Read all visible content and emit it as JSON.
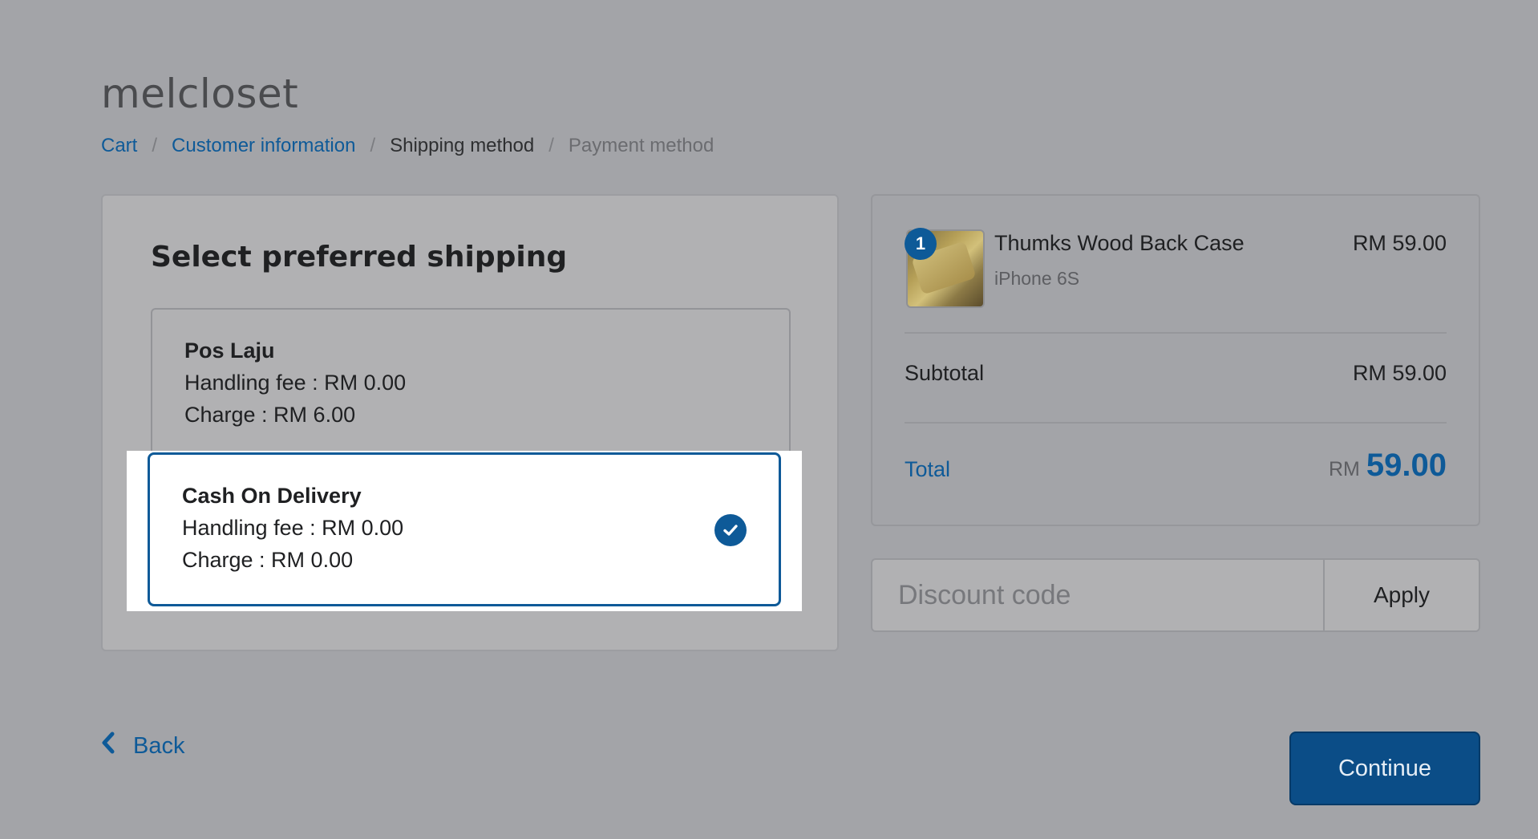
{
  "store": {
    "name": "melcloset"
  },
  "breadcrumb": {
    "items": [
      {
        "label": "Cart"
      },
      {
        "label": "Customer information"
      },
      {
        "label": "Shipping method"
      },
      {
        "label": "Payment method"
      }
    ],
    "separator": "/"
  },
  "shipping": {
    "title": "Select preferred shipping",
    "options": [
      {
        "name": "Pos Laju",
        "handling": "Handling fee : RM 0.00",
        "charge": "Charge : RM 6.00",
        "selected": false
      },
      {
        "name": "Cash On Delivery",
        "handling": "Handling fee : RM 0.00",
        "charge": "Charge : RM 0.00",
        "selected": true
      }
    ]
  },
  "summary": {
    "product": {
      "quantity": "1",
      "name": "Thumks Wood Back Case",
      "variant": "iPhone 6S",
      "price": "RM 59.00"
    },
    "subtotal_label": "Subtotal",
    "subtotal_value": "RM 59.00",
    "total_label": "Total",
    "total_currency": "RM",
    "total_amount": "59.00"
  },
  "discount": {
    "placeholder": "Discount code",
    "apply_label": "Apply"
  },
  "actions": {
    "back_label": "Back",
    "continue_label": "Continue"
  },
  "colors": {
    "accent": "#0e5a98",
    "background": "#a3a4a8"
  }
}
